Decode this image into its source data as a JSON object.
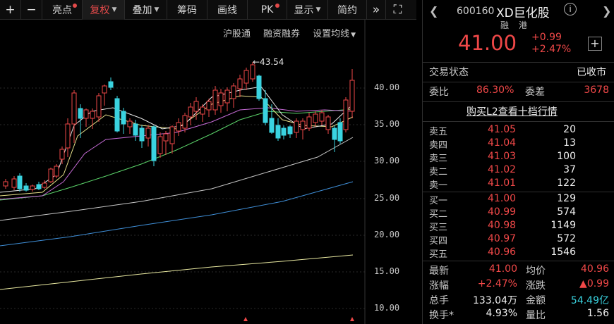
{
  "toolbar": {
    "zoom_in": "+",
    "zoom_out": "−",
    "highlight": "亮点",
    "adjust": "复权",
    "overlay": "叠加",
    "chips": "筹码",
    "draw": "画线",
    "pk": "PK",
    "display": "显示",
    "compact": "简约",
    "forward": "»",
    "fullscreen": "⛶"
  },
  "chart": {
    "subnav": {
      "index": "沪股通",
      "margin": "融资融券",
      "settings": "设置均线"
    },
    "max_label": "←43.54",
    "axis_ticks": [
      "40.00",
      "35.00",
      "30.00",
      "25.00",
      "20.00",
      "15.00",
      "10.00"
    ],
    "colors": {
      "up": "#f04848",
      "down": "#3ad3e0",
      "ma5": "#e8e8e8",
      "ma10": "#e8e08a",
      "ma20": "#c66bd6",
      "ma30": "#5bd46a",
      "ma60": "#c8c8c8",
      "ma120": "#3f8fd8",
      "ma250": "#e8e8a0"
    }
  },
  "stock": {
    "code": "600160",
    "name": "XD巨化股",
    "tag_margin": "融",
    "tag_hk": "港",
    "price": "41.00",
    "change": "+0.99",
    "change_pct": "+2.47%",
    "trade_status_label": "交易状态",
    "trade_status": "已收市",
    "weibi_label": "委比",
    "weibi": "86.30%",
    "weicha_label": "委差",
    "weicha": "3678",
    "level2_link": "购买L2查看十档行情"
  },
  "orderbook": {
    "asks": [
      {
        "label": "卖五",
        "price": "41.05",
        "vol": "20"
      },
      {
        "label": "卖四",
        "price": "41.04",
        "vol": "13"
      },
      {
        "label": "卖三",
        "price": "41.03",
        "vol": "100"
      },
      {
        "label": "卖二",
        "price": "41.02",
        "vol": "37"
      },
      {
        "label": "卖一",
        "price": "41.01",
        "vol": "122"
      }
    ],
    "bids": [
      {
        "label": "买一",
        "price": "41.00",
        "vol": "129"
      },
      {
        "label": "买二",
        "price": "40.99",
        "vol": "574"
      },
      {
        "label": "买三",
        "price": "40.98",
        "vol": "1149"
      },
      {
        "label": "买四",
        "price": "40.97",
        "vol": "572"
      },
      {
        "label": "买五",
        "price": "40.96",
        "vol": "1546"
      }
    ]
  },
  "stats": [
    {
      "l1": "最新",
      "v1": "41.00",
      "l2": "均价",
      "v2": "40.96"
    },
    {
      "l1": "涨幅",
      "v1": "+2.47%",
      "l2": "涨跌",
      "v2": "▲0.99"
    },
    {
      "l1": "总手",
      "v1": "133.04万",
      "l2": "金额",
      "v2": "54.49亿"
    },
    {
      "l1": "换手*",
      "v1": "4.93%",
      "l2": "量比",
      "v2": "1.56"
    }
  ]
}
